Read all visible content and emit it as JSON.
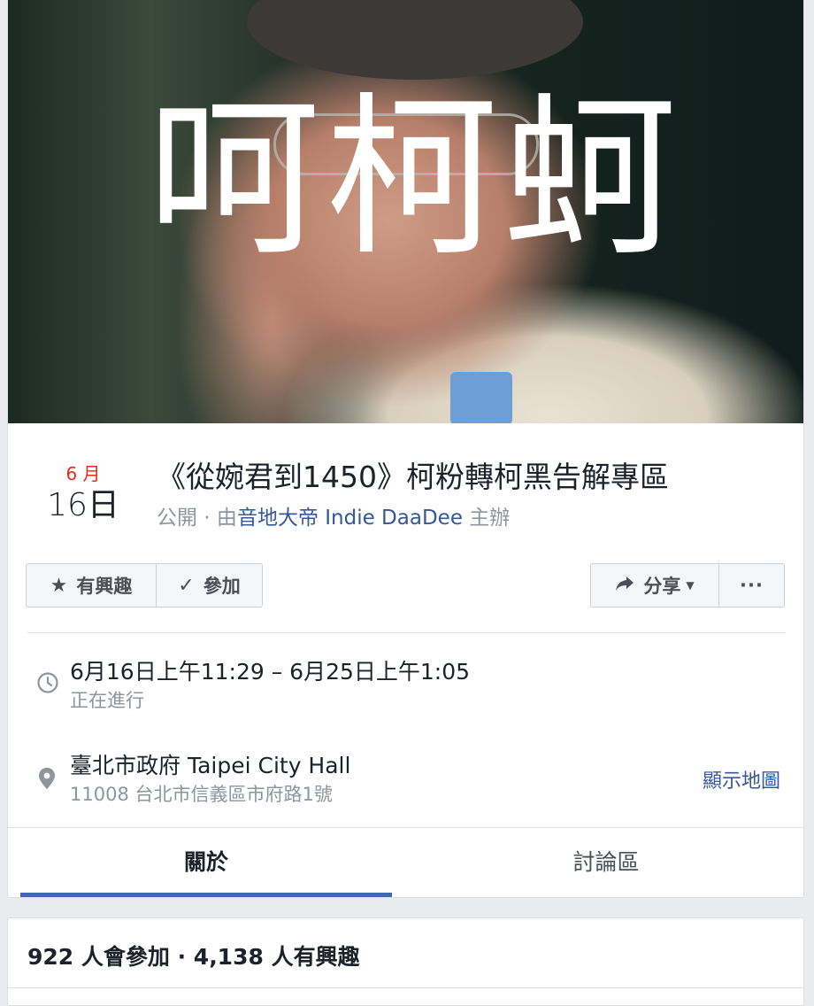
{
  "cover": {
    "title": "呵柯蚵"
  },
  "event": {
    "month": "6 月",
    "day": "16日",
    "title": "《從婉君到1450》柯粉轉柯黑告解專區",
    "privacy": "公開 · 由",
    "host": "音地大帝 Indie DaaDee",
    "host_suffix": " 主辦"
  },
  "actions": {
    "interested_label": "有興趣",
    "going_label": "參加",
    "share_label": "分享",
    "more_label": "···"
  },
  "details": {
    "time": "6月16日上午11:29 – 6月25日上午1:05",
    "status": "正在進行",
    "place": "臺北市政府 Taipei City Hall",
    "address": "11008 台北市信義區市府路1號",
    "map_link": "顯示地圖"
  },
  "tabs": [
    {
      "label": "關於"
    },
    {
      "label": "討論區"
    }
  ],
  "attendance": {
    "summary": "922 人會參加 · 4,138 人有興趣"
  }
}
